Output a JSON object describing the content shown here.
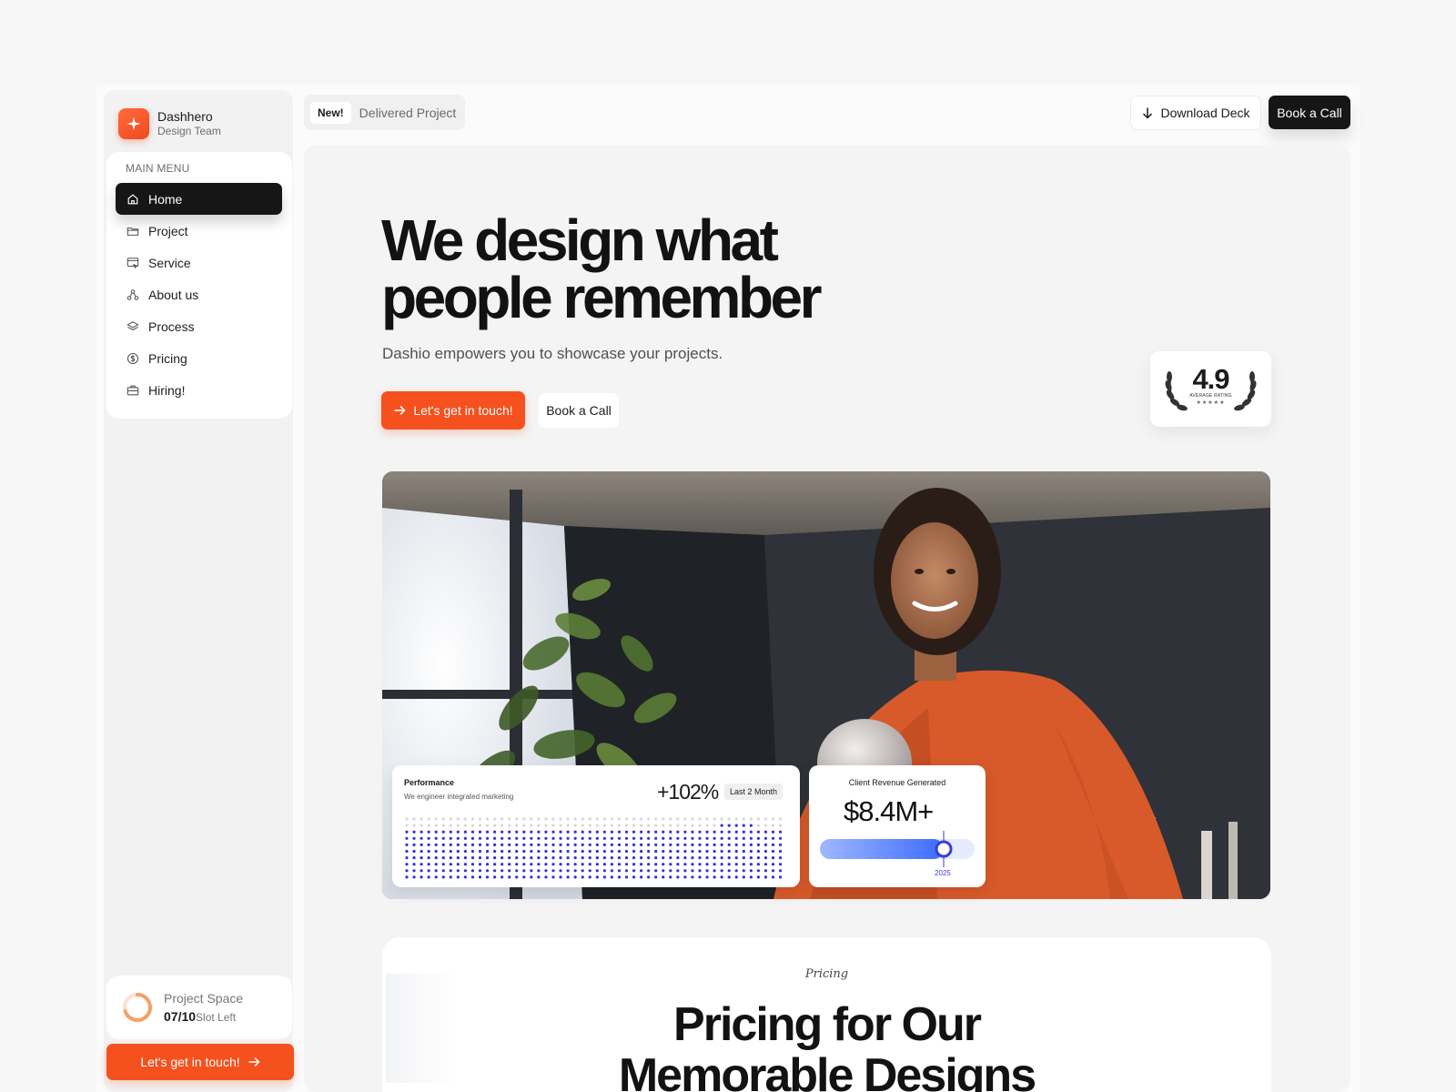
{
  "brand": {
    "name": "Dashhero",
    "team": "Design Team"
  },
  "sidebar": {
    "section_title": "MAIN MENU",
    "items": [
      {
        "label": "Home",
        "icon": "home-icon",
        "active": true
      },
      {
        "label": "Project",
        "icon": "folder-icon",
        "active": false
      },
      {
        "label": "Service",
        "icon": "service-icon",
        "active": false
      },
      {
        "label": "About us",
        "icon": "team-icon",
        "active": false
      },
      {
        "label": "Process",
        "icon": "layers-icon",
        "active": false
      },
      {
        "label": "Pricing",
        "icon": "dollar-icon",
        "active": false
      },
      {
        "label": "Hiring!",
        "icon": "briefcase-icon",
        "active": false
      }
    ],
    "project_space": {
      "title": "Project Space",
      "used": "07",
      "total": "/10",
      "unit": "Slot Left",
      "progress": 0.7
    },
    "cta_label": "Let's get in touch!"
  },
  "topbar": {
    "badge": "New!",
    "badge_label": "Delivered Project",
    "download_label": "Download Deck",
    "call_label": "Book a Call"
  },
  "hero": {
    "title_line1": "We design what",
    "title_line2": "people remember",
    "subtitle": "Dashio empowers you to showcase your projects.",
    "cta_primary": "Let's get in touch!",
    "cta_secondary": "Book a Call"
  },
  "rating": {
    "value": "4.9",
    "label": "AVERAGE RATING",
    "stars": "★★★★★"
  },
  "performance": {
    "title": "Performance",
    "subtitle": "We engineer integrated marketing",
    "value": "+102%",
    "period": "Last 2 Month"
  },
  "revenue": {
    "title": "Client Revenue Generated",
    "value": "$8.4M+",
    "year": "2025",
    "progress": 0.8
  },
  "pricing": {
    "eyebrow": "Pricing",
    "title_line1": "Pricing for Our",
    "title_line2": "Memorable Designs"
  },
  "colors": {
    "accent": "#f4511e",
    "dark": "#161616",
    "chart_blue": "#3a2ee0"
  }
}
